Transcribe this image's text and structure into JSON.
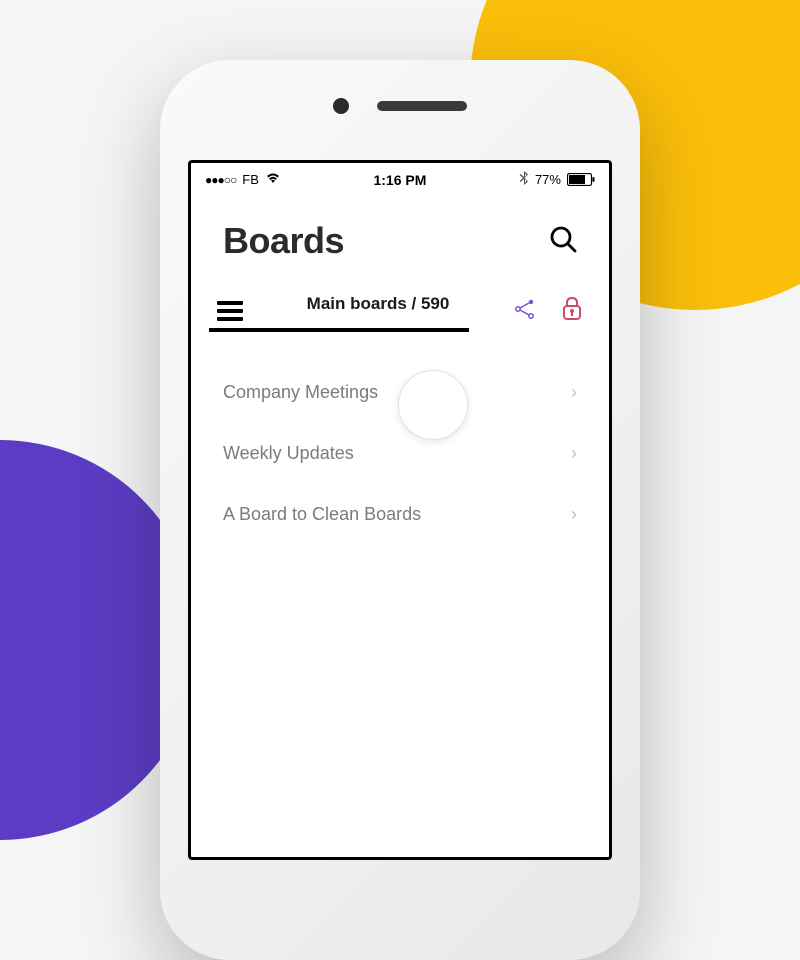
{
  "status_bar": {
    "signal": "●●●○○",
    "carrier": "FB",
    "time": "1:16 PM",
    "battery_pct": "77%"
  },
  "header": {
    "title": "Boards"
  },
  "tabs": {
    "active": "Main boards / 590"
  },
  "items": [
    {
      "label": "Company Meetings"
    },
    {
      "label": "Weekly Updates"
    },
    {
      "label": "A Board to Clean Boards"
    }
  ],
  "colors": {
    "yellow": "#fbbf0a",
    "purple": "#5c3cc4",
    "share": "#7b4fcf",
    "lock": "#c94b6a"
  }
}
